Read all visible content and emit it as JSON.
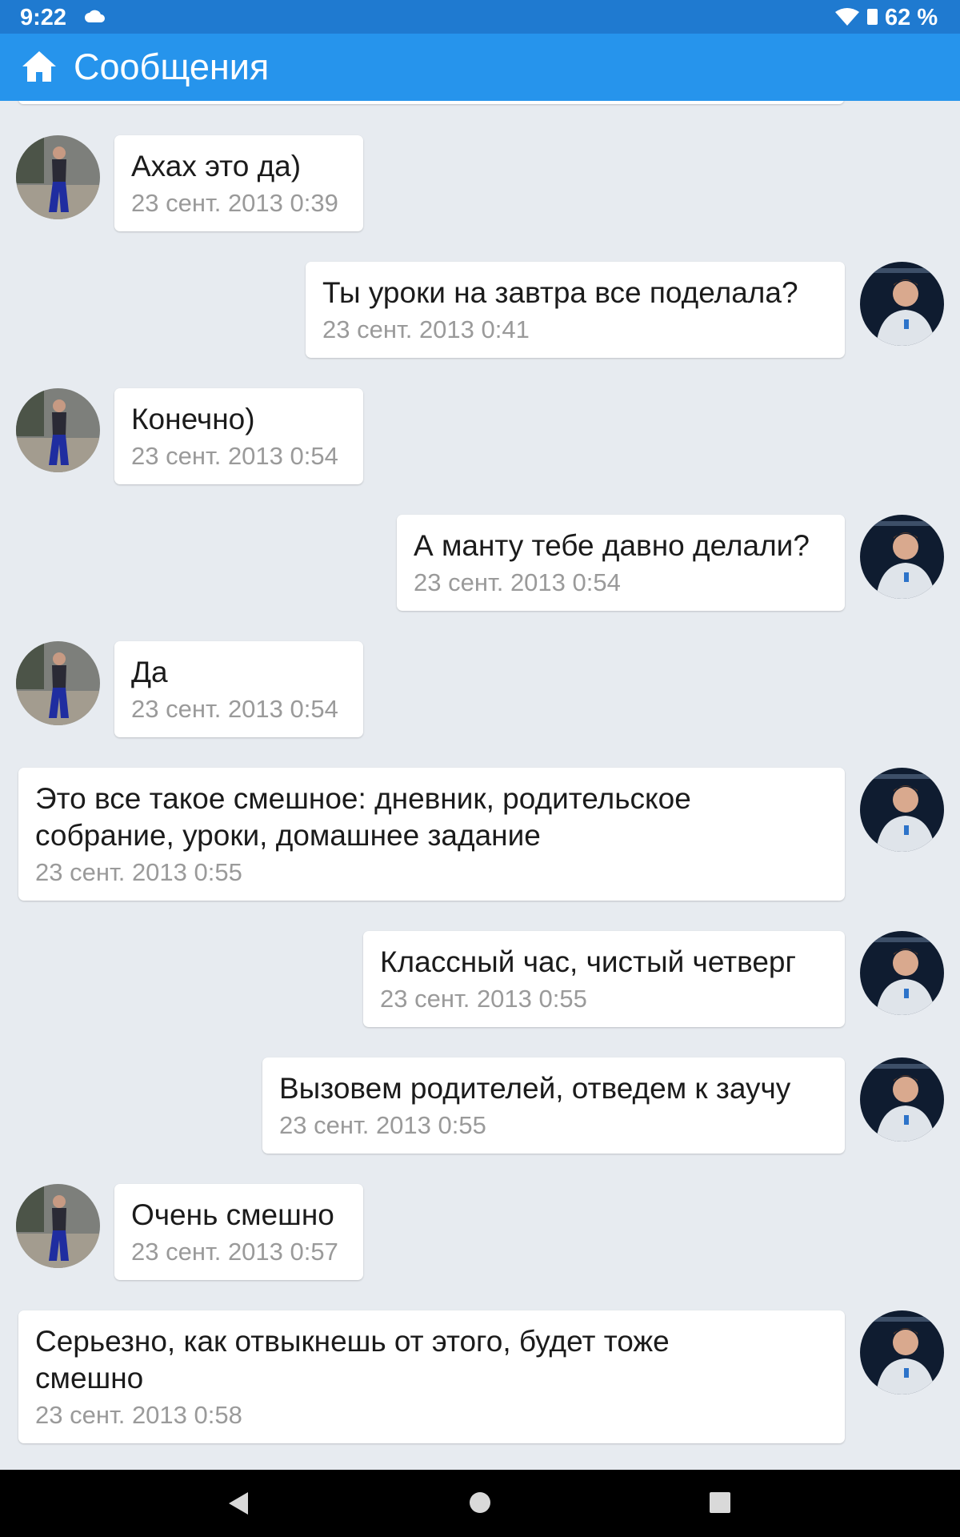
{
  "status_bar": {
    "time": "9:22",
    "battery": "62 %"
  },
  "header": {
    "title": "Сообщения"
  },
  "colors": {
    "status_bar": "#1f7ad0",
    "app_bar": "#2694ec",
    "background": "#e7ebf0",
    "timestamp": "#9a9a9a"
  },
  "messages": [
    {
      "side": "left",
      "text": "Ахах это да)",
      "time": "23 сент. 2013 0:39"
    },
    {
      "side": "right",
      "text": "Ты уроки на завтра все поделала?",
      "time": "23 сент. 2013 0:41"
    },
    {
      "side": "left",
      "text": "Конечно)",
      "time": "23 сент. 2013 0:54"
    },
    {
      "side": "right",
      "text": "А манту тебе давно делали?",
      "time": "23 сент. 2013 0:54"
    },
    {
      "side": "left",
      "text": "Да",
      "time": "23 сент. 2013 0:54"
    },
    {
      "side": "right",
      "text": "Это все такое смешное: дневник, родительское\nсобрание, уроки, домашнее задание",
      "time": "23 сент. 2013 0:55"
    },
    {
      "side": "right",
      "text": "Классный час, чистый четверг",
      "time": "23 сент. 2013 0:55"
    },
    {
      "side": "right",
      "text": "Вызовем родителей, отведем к заучу",
      "time": "23 сент. 2013 0:55"
    },
    {
      "side": "left",
      "text": "Очень смешно",
      "time": "23 сент. 2013 0:57"
    },
    {
      "side": "right",
      "text": "Серьезно, как отвыкнешь от этого, будет тоже\nсмешно",
      "time": "23 сент. 2013 0:58"
    }
  ],
  "icons": {
    "cloud": "cloud-icon",
    "wifi": "wifi-icon",
    "battery": "battery-icon",
    "home": "home-icon",
    "back": "back-icon",
    "home_nav": "home-nav-icon",
    "recents": "recents-icon"
  }
}
